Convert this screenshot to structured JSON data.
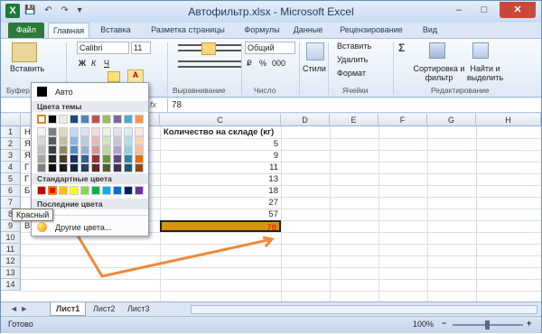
{
  "window": {
    "title": "Автофильтр.xlsx - Microsoft Excel",
    "minimize": "–",
    "maximize": "□",
    "close": "✕"
  },
  "qat": {
    "save": "💾",
    "undo": "↶",
    "redo": "↷",
    "customize": "▾"
  },
  "tabs": [
    "Файл",
    "Главная",
    "Вставка",
    "Разметка страницы",
    "Формулы",
    "Данные",
    "Рецензирование",
    "Вид"
  ],
  "ribbon": {
    "paste": "Вставить",
    "clipboard_group": "Буфер",
    "font_name": "Calibri",
    "font_size": "11",
    "bold": "Ж",
    "italic": "К",
    "underline": "Ч",
    "font_color_letter": "А",
    "align_group": "Выравнивание",
    "number_format": "Общий",
    "number_group": "Число",
    "styles": "Стили",
    "insert_cells": "Вставить",
    "delete_cells": "Удалить",
    "format_cells": "Формат",
    "cells_group": "Ячейки",
    "sigma": "Σ",
    "sort_filter": "Сортировка и фильтр",
    "find_select": "Найти и выделить",
    "editing_group": "Редактирование",
    "percent": "%",
    "thousands": "000",
    "currency": "₽"
  },
  "formula_bar": {
    "fx": "fx",
    "value": "78"
  },
  "columns": [
    "C",
    "D",
    "E",
    "F",
    "G",
    "H"
  ],
  "rows": [
    "1",
    "2",
    "3",
    "4",
    "5",
    "6",
    "7",
    "8",
    "9",
    "10",
    "11",
    "12",
    "13",
    "14"
  ],
  "cells": {
    "header_c": "Количество на складе (кг)",
    "col_a_partial": [
      "Н",
      "Я",
      "Я",
      "Г",
      "Г",
      "Б",
      "",
      "Я"
    ],
    "a9": "Вишня",
    "b9": "В",
    "values": [
      "5",
      "9",
      "11",
      "13",
      "18",
      "27",
      "57",
      "78"
    ]
  },
  "sheet_tabs": [
    "Лист1",
    "Лист2",
    "Лист3"
  ],
  "status": {
    "ready": "Готово",
    "zoom": "100%",
    "zoom_minus": "−",
    "zoom_plus": "+"
  },
  "color_popup": {
    "auto": "Авто",
    "theme_colors": "Цвета темы",
    "standard_colors": "Стандартные цвета",
    "recent_colors": "Последние цвета",
    "more_colors": "Другие цвета...",
    "theme_top": [
      "#ffffff",
      "#000000",
      "#eeece1",
      "#1f497d",
      "#4f81bd",
      "#c0504d",
      "#9bbb59",
      "#8064a2",
      "#4bacc6",
      "#f79646"
    ],
    "theme_shades": [
      [
        "#f2f2f2",
        "#7f7f7f",
        "#ddd9c3",
        "#c6d9f0",
        "#dbe5f1",
        "#f2dcdb",
        "#ebf1dd",
        "#e5e0ec",
        "#dbeef3",
        "#fdeada"
      ],
      [
        "#d8d8d8",
        "#595959",
        "#c4bd97",
        "#8db3e2",
        "#b8cce4",
        "#e5b9b7",
        "#d7e3bc",
        "#ccc1d9",
        "#b7dde8",
        "#fbd5b5"
      ],
      [
        "#bfbfbf",
        "#3f3f3f",
        "#938953",
        "#548dd4",
        "#95b3d7",
        "#d99694",
        "#c3d69b",
        "#b2a2c7",
        "#92cddc",
        "#fac08f"
      ],
      [
        "#a5a5a5",
        "#262626",
        "#494429",
        "#17365d",
        "#366092",
        "#953734",
        "#76923c",
        "#5f497a",
        "#31859b",
        "#e36c09"
      ],
      [
        "#7f7f7f",
        "#0c0c0c",
        "#1d1b10",
        "#0f243e",
        "#244061",
        "#632423",
        "#4f6128",
        "#3f3151",
        "#205867",
        "#974806"
      ]
    ],
    "standard": [
      "#c00000",
      "#ff0000",
      "#ffc000",
      "#ffff00",
      "#92d050",
      "#00b050",
      "#00b0f0",
      "#0070c0",
      "#002060",
      "#7030a0"
    ],
    "tooltip": "Красный"
  },
  "highlight_fill": "#d4960f",
  "highlight_text": "#ff0000",
  "arrow_color": "#f08a3a"
}
